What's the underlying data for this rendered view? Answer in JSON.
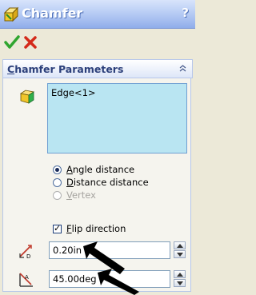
{
  "window": {
    "title": "Chamfer",
    "help": "?"
  },
  "actions": {
    "ok_icon": "green-check-icon",
    "cancel_icon": "red-x-icon"
  },
  "group": {
    "title_underlined": "C",
    "title_rest": "hamfer Parameters",
    "selection_item": "Edge<1>",
    "options": [
      {
        "u": "A",
        "rest": "ngle distance",
        "checked": true,
        "disabled": false
      },
      {
        "u": "D",
        "rest": "istance distance",
        "checked": false,
        "disabled": false
      },
      {
        "u": "V",
        "rest": "ertex",
        "checked": false,
        "disabled": true
      }
    ],
    "flip": {
      "u": "F",
      "rest": "lip direction",
      "checked": true
    },
    "distance_value": "0.20in",
    "angle_value": "45.00deg"
  },
  "colors": {
    "title_bar": "#a7bff0",
    "selection_box": "#b9e5f2",
    "group_title": "#2b3f7a"
  }
}
